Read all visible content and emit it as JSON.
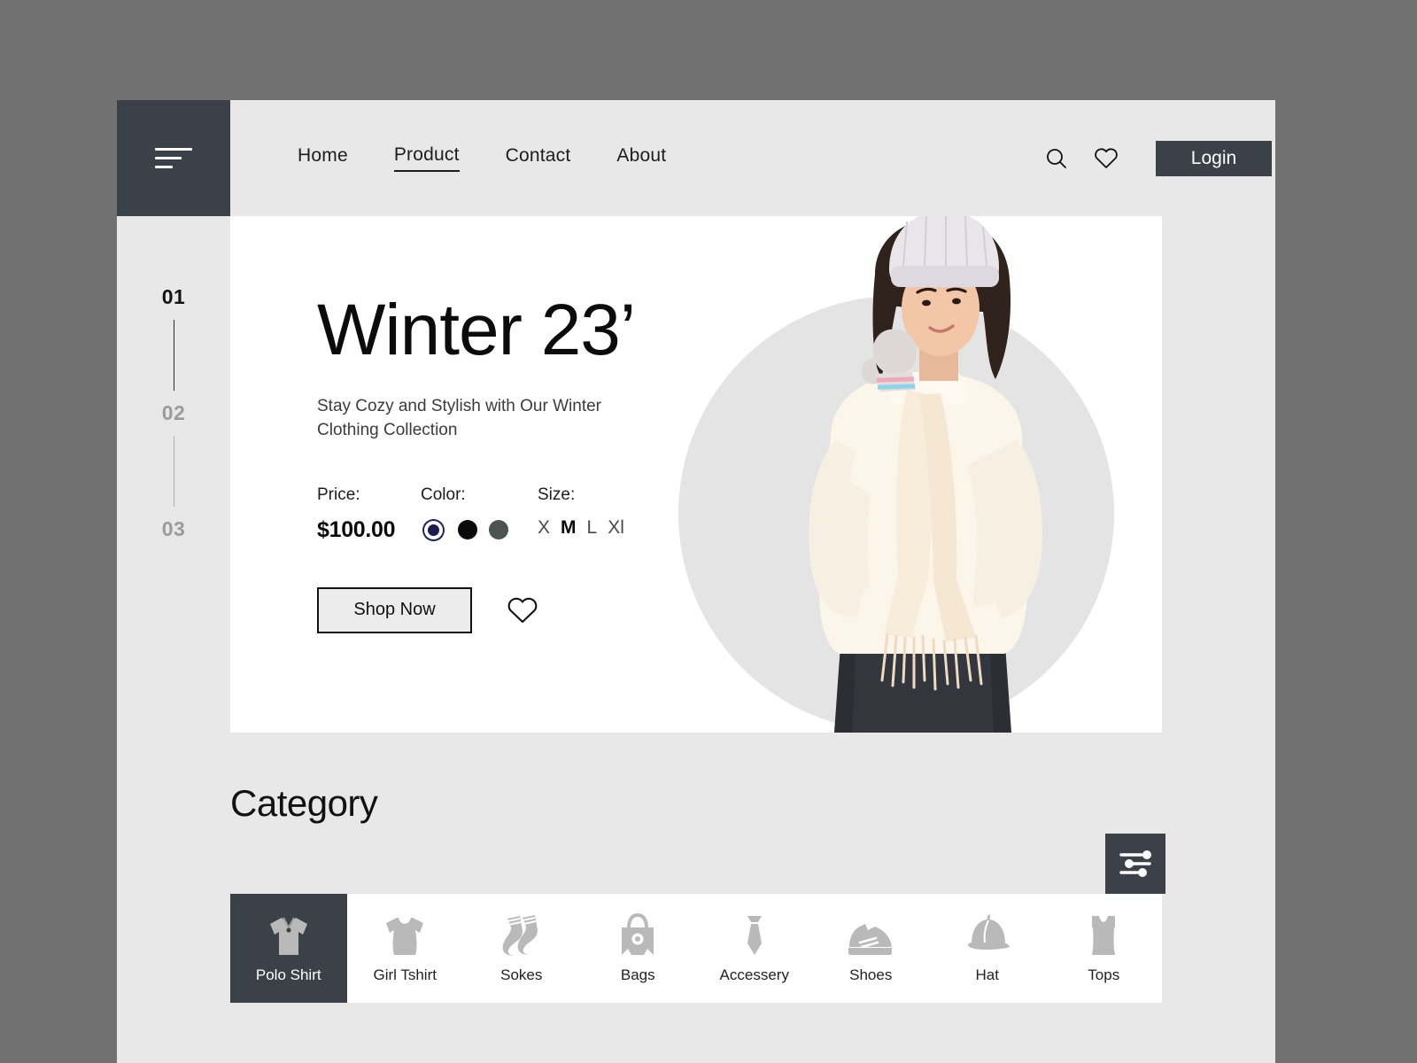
{
  "theme": {
    "outer_bg": "#717171",
    "page_bg": "#e8e8e8",
    "dark": "#3b4049",
    "card_bg": "#ffffff",
    "accent_navy": "#231f5e"
  },
  "header": {
    "menu_icon": "hamburger-icon",
    "nav": [
      {
        "label": "Home",
        "active": false
      },
      {
        "label": "Product",
        "active": true
      },
      {
        "label": "Contact",
        "active": false
      },
      {
        "label": "About",
        "active": false
      }
    ],
    "search_icon": "search-icon",
    "wishlist_icon": "heart-icon",
    "login_label": "Login"
  },
  "rail": {
    "items": [
      {
        "label": "01",
        "active": true
      },
      {
        "label": "02",
        "active": false
      },
      {
        "label": "03",
        "active": false
      }
    ]
  },
  "hero": {
    "title": "Winter 23’",
    "subtitle": "Stay Cozy and Stylish with Our Winter Clothing Collection",
    "price_label": "Price:",
    "price_value": "$100.00",
    "color_label": "Color:",
    "colors": [
      {
        "name": "navy",
        "hex": "#1c1a4e",
        "selected": true
      },
      {
        "name": "black",
        "hex": "#0a0a0a",
        "selected": false
      },
      {
        "name": "charcoal",
        "hex": "#4c5350",
        "selected": false
      }
    ],
    "size_label": "Size:",
    "sizes": [
      {
        "label": "X",
        "selected": false
      },
      {
        "label": "M",
        "selected": true
      },
      {
        "label": "L",
        "selected": false
      },
      {
        "label": "Xl",
        "selected": false
      }
    ],
    "shop_label": "Shop Now",
    "favorite_icon": "heart-icon",
    "image_alt": "model-winter-outfit"
  },
  "category": {
    "title": "Category",
    "filter_icon": "sliders-icon",
    "items": [
      {
        "label": "Polo Shirt",
        "icon": "polo-shirt-icon",
        "active": true
      },
      {
        "label": "Girl Tshirt",
        "icon": "girl-tshirt-icon",
        "active": false
      },
      {
        "label": "Sokes",
        "icon": "socks-icon",
        "active": false
      },
      {
        "label": "Bags",
        "icon": "bag-icon",
        "active": false
      },
      {
        "label": "Accessery",
        "icon": "tie-icon",
        "active": false
      },
      {
        "label": "Shoes",
        "icon": "shoe-icon",
        "active": false
      },
      {
        "label": "Hat",
        "icon": "cap-icon",
        "active": false
      },
      {
        "label": "Tops",
        "icon": "tank-top-icon",
        "active": false
      }
    ]
  }
}
